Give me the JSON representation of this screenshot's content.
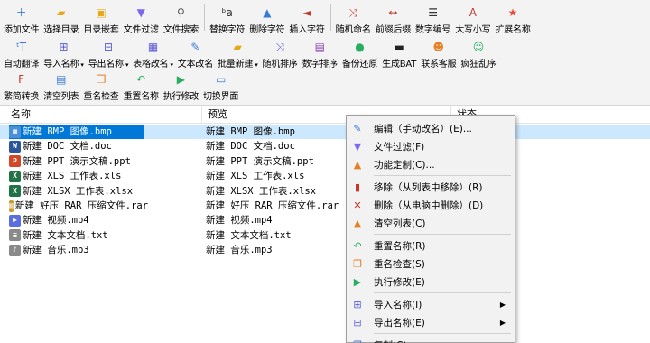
{
  "toolbar": {
    "row1": [
      {
        "label": "添加文件",
        "icon": "add-file-icon",
        "glyph": "＋",
        "color": "#3a7bd5"
      },
      {
        "label": "选择目录",
        "icon": "folder-icon",
        "glyph": "▰",
        "color": "#e6a817"
      },
      {
        "label": "目录嵌套",
        "icon": "nested-folder-icon",
        "glyph": "▣",
        "color": "#e6a817"
      },
      {
        "label": "文件过滤",
        "icon": "filter-icon",
        "glyph": "▼",
        "color": "#7b68ee"
      },
      {
        "label": "文件搜索",
        "icon": "search-icon",
        "glyph": "⚲",
        "color": "#555555"
      },
      {
        "label": "替换字符",
        "icon": "replace-icon",
        "glyph": "ᵇa",
        "color": "#333333"
      },
      {
        "label": "删除字符",
        "icon": "delete-char-icon",
        "glyph": "▲",
        "color": "#3a7bd5"
      },
      {
        "label": "插入字符",
        "icon": "insert-char-icon",
        "glyph": "◄",
        "color": "#c0392b"
      },
      {
        "label": "随机命名",
        "icon": "shuffle-icon",
        "glyph": "⤨",
        "color": "#c0392b"
      },
      {
        "label": "前缀后缀",
        "icon": "prefix-suffix-icon",
        "glyph": "↔",
        "color": "#c0392b"
      },
      {
        "label": "数字编号",
        "icon": "numbering-icon",
        "glyph": "☰",
        "color": "#333333"
      },
      {
        "label": "大写小写",
        "icon": "case-icon",
        "glyph": "A",
        "color": "#c0392b"
      },
      {
        "label": "扩展名称",
        "icon": "star-icon",
        "glyph": "★",
        "color": "#e74c3c"
      }
    ],
    "row2": [
      {
        "label": "自动翻译",
        "icon": "translate-icon",
        "glyph": "ᵗT",
        "color": "#3a7bd5",
        "dropdown": false
      },
      {
        "label": "导入名称",
        "icon": "import-icon",
        "glyph": "⊞",
        "color": "#5b5bd6",
        "dropdown": true
      },
      {
        "label": "导出名称",
        "icon": "export-icon",
        "glyph": "⊟",
        "color": "#5b5bd6",
        "dropdown": true
      },
      {
        "label": "表格改名",
        "icon": "table-icon",
        "glyph": "▦",
        "color": "#5b5bd6",
        "dropdown": true
      },
      {
        "label": "文本改名",
        "icon": "edit-icon",
        "glyph": "✎",
        "color": "#3a7bd5",
        "dropdown": false
      },
      {
        "label": "批量新建",
        "icon": "new-folder-icon",
        "glyph": "▰",
        "color": "#e6a817",
        "dropdown": true
      },
      {
        "label": "随机排序",
        "icon": "random-sort-icon",
        "glyph": "⤨",
        "color": "#5b5bd6",
        "dropdown": false
      },
      {
        "label": "数字排序",
        "icon": "number-sort-icon",
        "glyph": "▤",
        "color": "#8e44ad",
        "dropdown": false
      },
      {
        "label": "备份还原",
        "icon": "backup-icon",
        "glyph": "●",
        "color": "#27ae60",
        "dropdown": false
      },
      {
        "label": "生成BAT",
        "icon": "bat-icon",
        "glyph": "▬",
        "color": "#222222",
        "dropdown": false
      },
      {
        "label": "联系客服",
        "icon": "support-icon",
        "glyph": "☻",
        "color": "#e67e22",
        "dropdown": false
      },
      {
        "label": "疯狂乱序",
        "icon": "crazy-shuffle-icon",
        "glyph": "☺",
        "color": "#27ae60",
        "dropdown": false
      }
    ],
    "row3": [
      {
        "label": "繁简转换",
        "icon": "convert-icon",
        "glyph": "F",
        "color": "#c0392b"
      },
      {
        "label": "清空列表",
        "icon": "clear-list-icon",
        "glyph": "▤",
        "color": "#3a7bd5"
      },
      {
        "label": "重名检查",
        "icon": "duplicate-check-icon",
        "glyph": "❐",
        "color": "#e67e22"
      },
      {
        "label": "重置名称",
        "icon": "reset-icon",
        "glyph": "↶",
        "color": "#27ae60"
      },
      {
        "label": "执行修改",
        "icon": "execute-icon",
        "glyph": "▶",
        "color": "#27ae60"
      },
      {
        "label": "切换界面",
        "icon": "switch-ui-icon",
        "glyph": "▭",
        "color": "#3a7bd5"
      }
    ]
  },
  "list": {
    "headers": {
      "name": "名称",
      "preview": "预览",
      "status": "状态"
    },
    "rows": [
      {
        "name": "新建 BMP 图像.bmp",
        "preview": "新建 BMP 图像.bmp",
        "icon": "bmp-file-icon",
        "glyph": "▦",
        "color": "#4a90d9",
        "selected": true
      },
      {
        "name": "新建 DOC 文档.doc",
        "preview": "新建 DOC 文档.doc",
        "icon": "doc-file-icon",
        "glyph": "W",
        "color": "#2b579a",
        "selected": false
      },
      {
        "name": "新建 PPT 演示文稿.ppt",
        "preview": "新建 PPT 演示文稿.ppt",
        "icon": "ppt-file-icon",
        "glyph": "P",
        "color": "#d24726",
        "selected": false
      },
      {
        "name": "新建 XLS 工作表.xls",
        "preview": "新建 XLS 工作表.xls",
        "icon": "xls-file-icon",
        "glyph": "X",
        "color": "#217346",
        "selected": false
      },
      {
        "name": "新建 XLSX 工作表.xlsx",
        "preview": "新建 XLSX 工作表.xlsx",
        "icon": "xlsx-file-icon",
        "glyph": "X",
        "color": "#217346",
        "selected": false
      },
      {
        "name": "新建 好压 RAR 压缩文件.rar",
        "preview": "新建 好压 RAR 压缩文件.rar",
        "icon": "rar-file-icon",
        "glyph": "▥",
        "color": "#c89b2c",
        "selected": false
      },
      {
        "name": "新建 视频.mp4",
        "preview": "新建 视频.mp4",
        "icon": "video-file-icon",
        "glyph": "▶",
        "color": "#5b6ee1",
        "selected": false
      },
      {
        "name": "新建 文本文档.txt",
        "preview": "新建 文本文档.txt",
        "icon": "txt-file-icon",
        "glyph": "≡",
        "color": "#8a8a8a",
        "selected": false
      },
      {
        "name": "新建 音乐.mp3",
        "preview": "新建 音乐.mp3",
        "icon": "audio-file-icon",
        "glyph": "♪",
        "color": "#8a8a8a",
        "selected": false
      }
    ]
  },
  "context_menu": {
    "items": [
      {
        "label": "编辑（手动改名）(E)...",
        "icon": "edit-icon",
        "glyph": "✎",
        "color": "#3a7bd5",
        "submenu": false
      },
      {
        "label": "文件过滤(F)",
        "icon": "filter-icon",
        "glyph": "▼",
        "color": "#7b68ee",
        "submenu": false
      },
      {
        "label": "功能定制(C)...",
        "icon": "customize-icon",
        "glyph": "▲",
        "color": "#e67e22",
        "submenu": false
      },
      {
        "label": "移除（从列表中移除）(R)",
        "icon": "remove-icon",
        "glyph": "▮",
        "color": "#c0392b",
        "submenu": false
      },
      {
        "label": "删除（从电脑中删除）(D)",
        "icon": "delete-icon",
        "glyph": "✕",
        "color": "#c0392b",
        "submenu": false
      },
      {
        "label": "清空列表(C)",
        "icon": "clear-list-icon",
        "glyph": "▲",
        "color": "#e67e22",
        "submenu": false
      },
      {
        "label": "重置名称(R)",
        "icon": "reset-icon",
        "glyph": "↶",
        "color": "#27ae60",
        "submenu": false
      },
      {
        "label": "重名检查(S)",
        "icon": "duplicate-check-icon",
        "glyph": "❐",
        "color": "#e67e22",
        "submenu": false
      },
      {
        "label": "执行修改(E)",
        "icon": "execute-icon",
        "glyph": "▶",
        "color": "#27ae60",
        "submenu": false
      },
      {
        "label": "导入名称(I)",
        "icon": "import-icon",
        "glyph": "⊞",
        "color": "#5b5bd6",
        "submenu": true
      },
      {
        "label": "导出名称(E)",
        "icon": "export-icon",
        "glyph": "⊟",
        "color": "#5b5bd6",
        "submenu": true
      },
      {
        "label": "复制(C)",
        "icon": "copy-icon",
        "glyph": "❐",
        "color": "#3a7bd5",
        "submenu": false
      }
    ],
    "submenu_arrow": "▶"
  }
}
